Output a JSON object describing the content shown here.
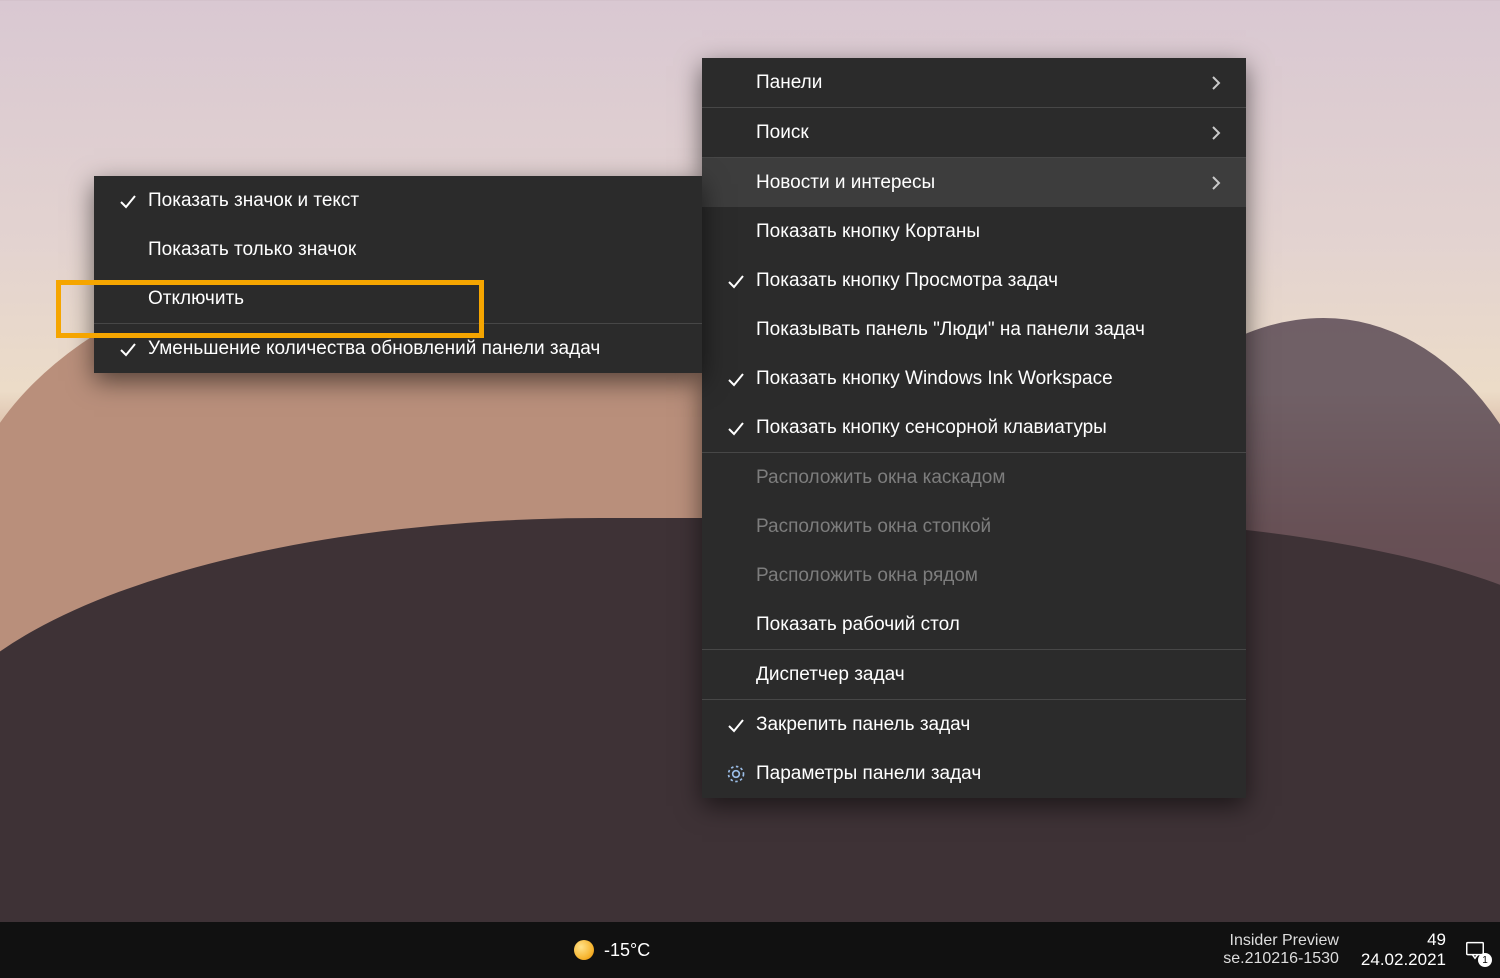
{
  "main_menu": {
    "panels": "Панели",
    "search": "Поиск",
    "news": "Новости и интересы",
    "cortana": "Показать кнопку Кортаны",
    "taskview": "Показать кнопку Просмотра задач",
    "people": "Показывать панель \"Люди\" на панели задач",
    "ink": "Показать кнопку Windows Ink Workspace",
    "touchkb": "Показать кнопку сенсорной клавиатуры",
    "cascade": "Расположить окна каскадом",
    "stack": "Расположить окна стопкой",
    "sidebyside": "Расположить окна рядом",
    "showdesktop": "Показать рабочий стол",
    "taskmgr": "Диспетчер задач",
    "lock": "Закрепить панель задач",
    "settings": "Параметры панели задач"
  },
  "sub_menu": {
    "icon_text": "Показать значок и текст",
    "icon_only": "Показать только значок",
    "disable": "Отключить",
    "reduce": "Уменьшение количества обновлений панели задач"
  },
  "taskbar": {
    "temp": "-15°C",
    "time": "49",
    "date": "24.02.2021",
    "build_line1": "Insider Preview",
    "build_line2": "se.210216-1530"
  },
  "colors": {
    "highlight": "#f5a500"
  }
}
